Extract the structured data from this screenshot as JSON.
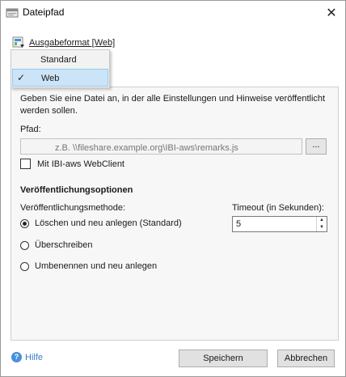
{
  "window": {
    "title": "Dateipfad",
    "title_icon": "window-icon",
    "close_icon": "close-icon"
  },
  "format": {
    "label": "Ausgabeformat [Web]",
    "icon": "format-icon"
  },
  "menu": {
    "items": [
      {
        "label": "Standard",
        "checked": false
      },
      {
        "label": "Web",
        "checked": true
      }
    ]
  },
  "panel": {
    "description": "Geben Sie eine Datei an, in der alle Einstellungen und Hinweise veröffentlicht werden sollen.",
    "path_label": "Pfad:",
    "path_placeholder": "z.B. \\\\fileshare.example.org\\IBI-aws\\remarks.js",
    "browse_label": "...",
    "webclient_label": "Mit IBI-aws WebClient",
    "webclient_checked": false,
    "section_title": "Veröffentlichungsoptionen",
    "method_label": "Veröffentlichungsmethode:",
    "methods": [
      {
        "label": "Löschen und neu anlegen (Standard)",
        "checked": true
      },
      {
        "label": "Überschreiben",
        "checked": false
      },
      {
        "label": "Umbenennen und neu anlegen",
        "checked": false
      }
    ],
    "timeout_label": "Timeout (in Sekunden):",
    "timeout_value": "5"
  },
  "footer": {
    "help_label": "Hilfe",
    "save_label": "Speichern",
    "cancel_label": "Abbrechen"
  }
}
